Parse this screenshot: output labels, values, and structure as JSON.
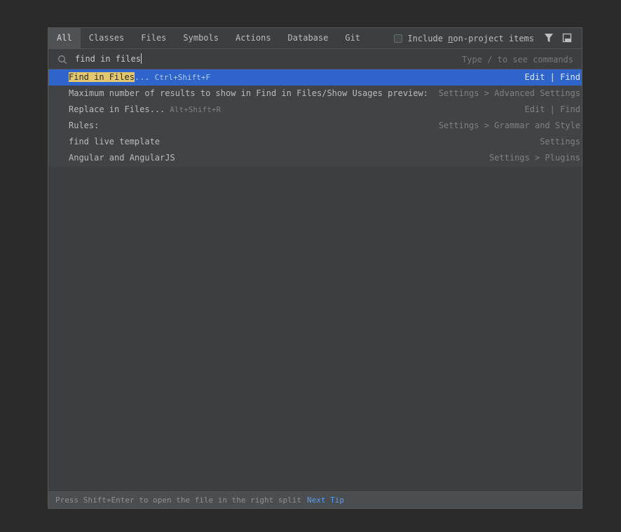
{
  "tabs": [
    {
      "label": "All",
      "selected": true
    },
    {
      "label": "Classes"
    },
    {
      "label": "Files"
    },
    {
      "label": "Symbols"
    },
    {
      "label": "Actions"
    },
    {
      "label": "Database"
    },
    {
      "label": "Git"
    }
  ],
  "include_option": {
    "before": "Include ",
    "mnemonic": "n",
    "after": "on-project items",
    "checked": false
  },
  "icons": {
    "filter": "filter-icon",
    "pin": "pin-window-icon",
    "search": "search-icon"
  },
  "search": {
    "value": "find in files",
    "hint": "Type / to see commands"
  },
  "results": [
    {
      "highlight": "Find in Files",
      "rest": "...",
      "shortcut": "Ctrl+Shift+F",
      "location": "Edit | Find",
      "selected": true
    },
    {
      "highlight": "",
      "rest": "Maximum number of results to show in Find in Files/Show Usages preview:",
      "shortcut": "",
      "location": "Settings > Advanced Settings"
    },
    {
      "highlight": "",
      "rest": "Replace in Files...",
      "shortcut": "Alt+Shift+R",
      "location": "Edit | Find"
    },
    {
      "highlight": "",
      "rest": "Rules:",
      "shortcut": "",
      "location": "Settings > Grammar and Style"
    },
    {
      "highlight": "",
      "rest": "find live template",
      "shortcut": "",
      "location": "Settings"
    },
    {
      "highlight": "",
      "rest": "Angular and AngularJS",
      "shortcut": "",
      "location": "Settings > Plugins"
    }
  ],
  "footer": {
    "tip": "Press Shift+Enter to open the file in the right split",
    "next_tip": "Next Tip"
  },
  "colors": {
    "selection": "#2f65ca",
    "highlight": "#e2c76e",
    "link": "#589df6"
  }
}
